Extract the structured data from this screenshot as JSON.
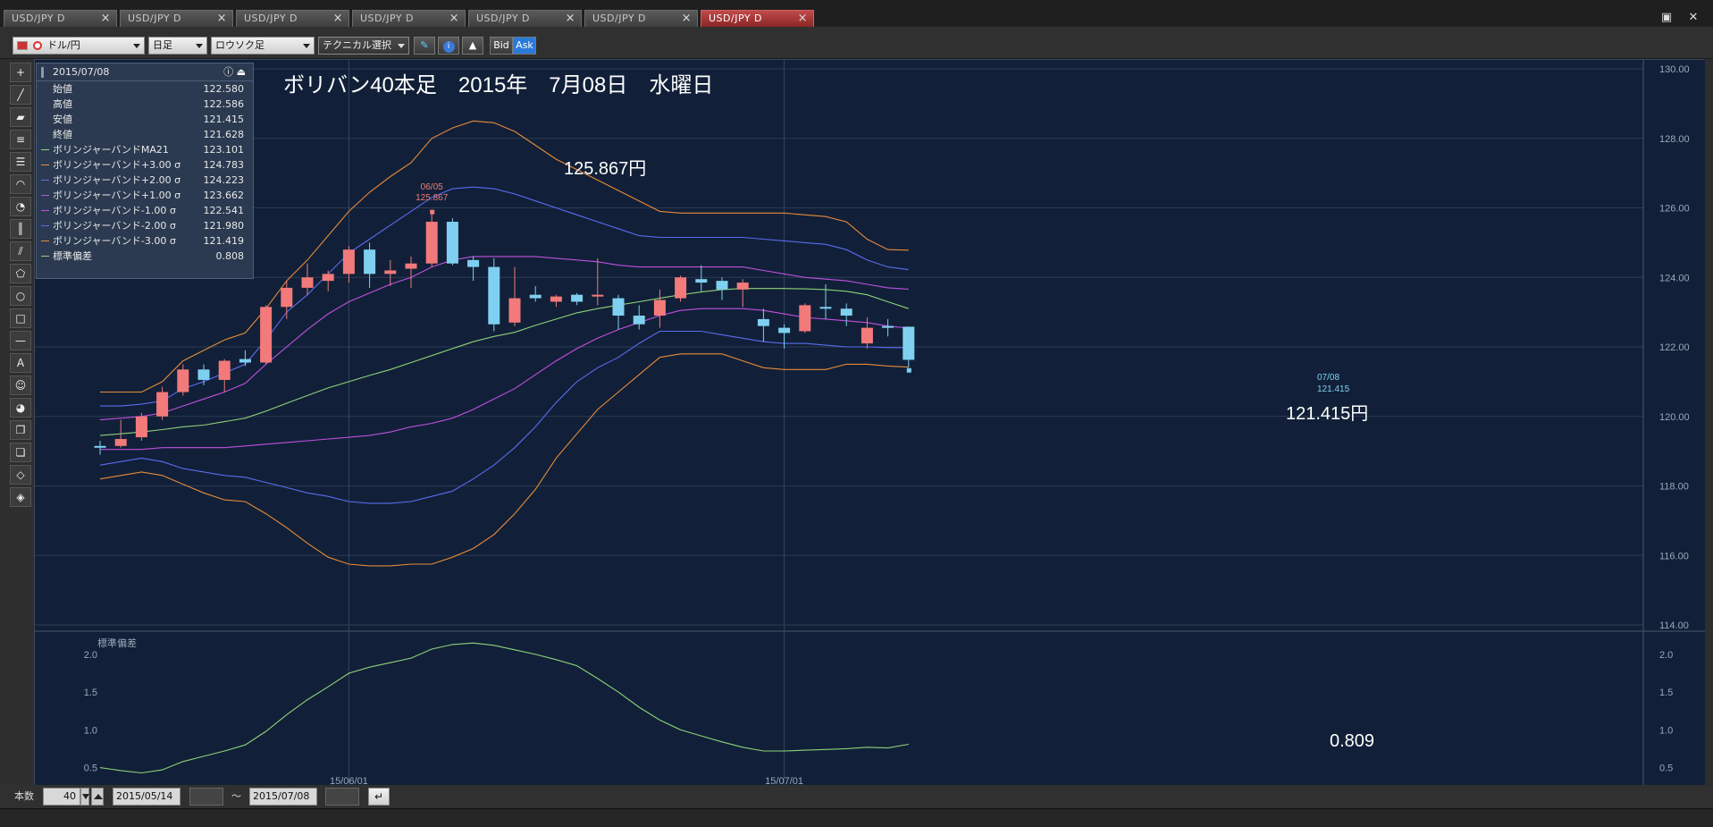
{
  "tabs": [
    {
      "label": "USD/JPY D",
      "active": false
    },
    {
      "label": "USD/JPY D",
      "active": false
    },
    {
      "label": "USD/JPY D",
      "active": false
    },
    {
      "label": "USD/JPY D",
      "active": false
    },
    {
      "label": "USD/JPY D",
      "active": false
    },
    {
      "label": "USD/JPY D",
      "active": false
    },
    {
      "label": "USD/JPY D",
      "active": true
    }
  ],
  "toolbar": {
    "pair": "ドル/円",
    "period": "日足",
    "chart_type": "ロウソク足",
    "technical": "テクニカル選択",
    "bid": "Bid",
    "ask": "Ask"
  },
  "tool_icons": [
    "crosshair-icon",
    "trendline-icon",
    "ruler-icon",
    "horizontal-lines-icon",
    "fibonacci-icon",
    "fan-icon",
    "arc-icon",
    "time-lines-icon",
    "channel-icon",
    "pentagon-icon",
    "circle-icon",
    "rectangle-icon",
    "hline-icon",
    "text-icon",
    "smiley-icon",
    "paint-icon",
    "copy-icon",
    "copy2-icon",
    "eraser-icon",
    "eraser-all-icon"
  ],
  "info": {
    "date": "2015/07/08",
    "rows": [
      {
        "label": "始値",
        "value": "122.580",
        "color": ""
      },
      {
        "label": "高値",
        "value": "122.586",
        "color": ""
      },
      {
        "label": "安値",
        "value": "121.415",
        "color": ""
      },
      {
        "label": "終値",
        "value": "121.628",
        "color": ""
      },
      {
        "label": "ボリンジャーバンドMA21",
        "value": "123.101",
        "color": "#8fd17a"
      },
      {
        "label": "ボリンジャーバンド+3.00 σ",
        "value": "124.783",
        "color": "#e88a3a"
      },
      {
        "label": "ボリンジャーバンド+2.00 σ",
        "value": "124.223",
        "color": "#5a6cf0"
      },
      {
        "label": "ボリンジャーバンド+1.00 σ",
        "value": "123.662",
        "color": "#c050e0"
      },
      {
        "label": "ボリンジャーバンド-1.00 σ",
        "value": "122.541",
        "color": "#c050e0"
      },
      {
        "label": "ボリンジャーバンド-2.00 σ",
        "value": "121.980",
        "color": "#5a6cf0"
      },
      {
        "label": "ボリンジャーバンド-3.00 σ",
        "value": "121.419",
        "color": "#e88a3a"
      },
      {
        "label": "標準偏差",
        "value": "0.808",
        "color": "#8fd17a"
      }
    ]
  },
  "annotations": {
    "title": "ボリバン40本足　2015年　7月08日　水曜日",
    "high_big": "125.867円",
    "high_small_date": "06/05",
    "high_small_value": "125.867",
    "low_big": "121.415円",
    "low_small_date": "07/08",
    "low_small_value": "121.415",
    "sd_value": "0.809",
    "sub_label": "標準偏差"
  },
  "bottom": {
    "count_label": "本数",
    "count": "40",
    "from": "2015/05/14",
    "tilde": "～",
    "to": "2015/07/08"
  },
  "colors": {
    "up": "#f27a7a",
    "down": "#7fd0f0",
    "ma": "#8fd17a",
    "s3": "#e88a3a",
    "s2": "#5a6cf0",
    "s1": "#c050e0",
    "bg": "#0d1a2c"
  },
  "chart_data": {
    "type": "candlestick",
    "y_ticks": [
      "130.00",
      "128.00",
      "126.00",
      "124.00",
      "122.00",
      "120.00",
      "118.00",
      "116.00",
      "114.00"
    ],
    "ylim": [
      114,
      130
    ],
    "sub_ticks": [
      "2.0",
      "1.5",
      "1.0",
      "0.5"
    ],
    "sub_ylim": [
      0.4,
      2.2
    ],
    "x_labels": [
      {
        "label": "15/06/01",
        "index": 12
      },
      {
        "label": "15/07/01",
        "index": 33
      }
    ],
    "candles": [
      {
        "o": 119.15,
        "h": 119.3,
        "l": 118.9,
        "c": 119.1
      },
      {
        "o": 119.15,
        "h": 119.9,
        "l": 119.1,
        "c": 119.35
      },
      {
        "o": 119.4,
        "h": 120.1,
        "l": 119.3,
        "c": 120.0
      },
      {
        "o": 120.0,
        "h": 120.85,
        "l": 119.9,
        "c": 120.7
      },
      {
        "o": 120.7,
        "h": 121.5,
        "l": 120.6,
        "c": 121.35
      },
      {
        "o": 121.35,
        "h": 121.5,
        "l": 120.9,
        "c": 121.05
      },
      {
        "o": 121.05,
        "h": 121.65,
        "l": 120.7,
        "c": 121.6
      },
      {
        "o": 121.65,
        "h": 121.9,
        "l": 121.45,
        "c": 121.55
      },
      {
        "o": 121.55,
        "h": 123.2,
        "l": 121.5,
        "c": 123.15
      },
      {
        "o": 123.15,
        "h": 123.9,
        "l": 122.8,
        "c": 123.7
      },
      {
        "o": 123.7,
        "h": 124.4,
        "l": 123.5,
        "c": 124.0
      },
      {
        "o": 123.9,
        "h": 124.2,
        "l": 123.6,
        "c": 124.1
      },
      {
        "o": 124.1,
        "h": 124.9,
        "l": 123.85,
        "c": 124.8
      },
      {
        "o": 124.8,
        "h": 125.0,
        "l": 123.7,
        "c": 124.1
      },
      {
        "o": 124.1,
        "h": 124.5,
        "l": 123.75,
        "c": 124.2
      },
      {
        "o": 124.25,
        "h": 124.6,
        "l": 123.7,
        "c": 124.4
      },
      {
        "o": 124.4,
        "h": 125.867,
        "l": 124.3,
        "c": 125.6
      },
      {
        "o": 125.6,
        "h": 125.7,
        "l": 124.35,
        "c": 124.4
      },
      {
        "o": 124.5,
        "h": 124.6,
        "l": 123.9,
        "c": 124.3
      },
      {
        "o": 124.3,
        "h": 124.55,
        "l": 122.45,
        "c": 122.65
      },
      {
        "o": 122.7,
        "h": 124.3,
        "l": 122.6,
        "c": 123.4
      },
      {
        "o": 123.5,
        "h": 123.75,
        "l": 123.3,
        "c": 123.4
      },
      {
        "o": 123.3,
        "h": 123.5,
        "l": 123.15,
        "c": 123.45
      },
      {
        "o": 123.5,
        "h": 123.55,
        "l": 123.2,
        "c": 123.3
      },
      {
        "o": 123.45,
        "h": 124.55,
        "l": 123.2,
        "c": 123.5
      },
      {
        "o": 123.4,
        "h": 123.5,
        "l": 122.5,
        "c": 122.9
      },
      {
        "o": 122.9,
        "h": 123.2,
        "l": 122.5,
        "c": 122.65
      },
      {
        "o": 122.9,
        "h": 123.65,
        "l": 122.55,
        "c": 123.35
      },
      {
        "o": 123.4,
        "h": 124.05,
        "l": 123.3,
        "c": 124.0
      },
      {
        "o": 123.95,
        "h": 124.35,
        "l": 123.6,
        "c": 123.85
      },
      {
        "o": 123.9,
        "h": 124.0,
        "l": 123.35,
        "c": 123.65
      },
      {
        "o": 123.65,
        "h": 123.95,
        "l": 123.15,
        "c": 123.85
      },
      {
        "o": 122.8,
        "h": 123.1,
        "l": 122.15,
        "c": 122.6
      },
      {
        "o": 122.55,
        "h": 122.65,
        "l": 121.95,
        "c": 122.4
      },
      {
        "o": 122.45,
        "h": 123.25,
        "l": 122.4,
        "c": 123.2
      },
      {
        "o": 123.15,
        "h": 123.8,
        "l": 122.8,
        "c": 123.1
      },
      {
        "o": 123.1,
        "h": 123.25,
        "l": 122.6,
        "c": 122.9
      },
      {
        "o": 122.1,
        "h": 122.85,
        "l": 121.95,
        "c": 122.55
      },
      {
        "o": 122.6,
        "h": 122.8,
        "l": 122.3,
        "c": 122.55
      },
      {
        "o": 122.58,
        "h": 122.586,
        "l": 121.415,
        "c": 121.628
      }
    ],
    "ma": [
      119.45,
      119.5,
      119.55,
      119.62,
      119.7,
      119.75,
      119.85,
      119.95,
      120.15,
      120.38,
      120.6,
      120.82,
      121.0,
      121.18,
      121.35,
      121.55,
      121.75,
      121.95,
      122.15,
      122.3,
      122.42,
      122.62,
      122.8,
      122.98,
      123.1,
      123.2,
      123.3,
      123.4,
      123.5,
      123.58,
      123.65,
      123.68,
      123.68,
      123.68,
      123.67,
      123.65,
      123.6,
      123.5,
      123.3,
      123.1
    ],
    "s3p": [
      120.7,
      120.7,
      120.7,
      121.0,
      121.6,
      121.9,
      122.2,
      122.4,
      123.1,
      123.9,
      124.5,
      125.2,
      125.9,
      126.45,
      126.9,
      127.3,
      128.0,
      128.3,
      128.5,
      128.45,
      128.2,
      127.8,
      127.4,
      127.1,
      126.8,
      126.5,
      126.2,
      125.9,
      125.85,
      125.85,
      125.85,
      125.85,
      125.85,
      125.85,
      125.8,
      125.75,
      125.6,
      125.1,
      124.8,
      124.783
    ],
    "s2p": [
      120.3,
      120.3,
      120.35,
      120.45,
      120.8,
      121.0,
      121.25,
      121.5,
      122.2,
      123.0,
      123.5,
      124.1,
      124.7,
      125.1,
      125.5,
      125.9,
      126.3,
      126.55,
      126.6,
      126.55,
      126.4,
      126.2,
      126.0,
      125.8,
      125.6,
      125.4,
      125.2,
      125.15,
      125.15,
      125.15,
      125.15,
      125.15,
      125.1,
      125.05,
      125.0,
      124.95,
      124.8,
      124.5,
      124.3,
      124.223
    ],
    "s1p": [
      119.9,
      119.95,
      120.0,
      120.1,
      120.3,
      120.5,
      120.7,
      120.95,
      121.5,
      122.0,
      122.5,
      122.95,
      123.3,
      123.55,
      123.8,
      124.0,
      124.3,
      124.5,
      124.6,
      124.6,
      124.6,
      124.6,
      124.55,
      124.5,
      124.45,
      124.35,
      124.3,
      124.3,
      124.3,
      124.3,
      124.3,
      124.3,
      124.2,
      124.1,
      124.0,
      123.95,
      123.9,
      123.8,
      123.7,
      123.662
    ],
    "s1m": [
      119.05,
      119.05,
      119.05,
      119.1,
      119.1,
      119.1,
      119.1,
      119.15,
      119.2,
      119.25,
      119.3,
      119.35,
      119.4,
      119.45,
      119.55,
      119.7,
      119.8,
      119.95,
      120.2,
      120.5,
      120.8,
      121.2,
      121.6,
      121.95,
      122.25,
      122.5,
      122.7,
      122.9,
      123.05,
      123.1,
      123.1,
      123.1,
      123.05,
      122.95,
      122.85,
      122.8,
      122.75,
      122.7,
      122.6,
      122.541
    ],
    "s2m": [
      118.6,
      118.7,
      118.8,
      118.7,
      118.5,
      118.4,
      118.3,
      118.25,
      118.1,
      117.95,
      117.8,
      117.7,
      117.55,
      117.5,
      117.5,
      117.55,
      117.7,
      117.85,
      118.2,
      118.6,
      119.1,
      119.7,
      120.4,
      121.0,
      121.4,
      121.7,
      122.1,
      122.45,
      122.45,
      122.45,
      122.35,
      122.25,
      122.15,
      122.1,
      122.1,
      122.05,
      122.0,
      122.0,
      121.98,
      121.98
    ],
    "s3m": [
      118.2,
      118.3,
      118.4,
      118.3,
      118.05,
      117.8,
      117.6,
      117.55,
      117.2,
      116.8,
      116.35,
      115.95,
      115.75,
      115.7,
      115.7,
      115.75,
      115.75,
      115.95,
      116.2,
      116.6,
      117.2,
      117.9,
      118.8,
      119.5,
      120.2,
      120.7,
      121.2,
      121.7,
      121.8,
      121.8,
      121.8,
      121.6,
      121.4,
      121.35,
      121.35,
      121.35,
      121.5,
      121.5,
      121.45,
      121.419
    ],
    "sd": [
      0.5,
      0.46,
      0.43,
      0.47,
      0.58,
      0.65,
      0.72,
      0.8,
      0.98,
      1.2,
      1.4,
      1.57,
      1.75,
      1.83,
      1.89,
      1.95,
      2.07,
      2.13,
      2.15,
      2.12,
      2.06,
      2.0,
      1.93,
      1.85,
      1.68,
      1.5,
      1.3,
      1.13,
      1.0,
      0.92,
      0.84,
      0.77,
      0.72,
      0.72,
      0.73,
      0.74,
      0.75,
      0.77,
      0.76,
      0.809
    ]
  }
}
